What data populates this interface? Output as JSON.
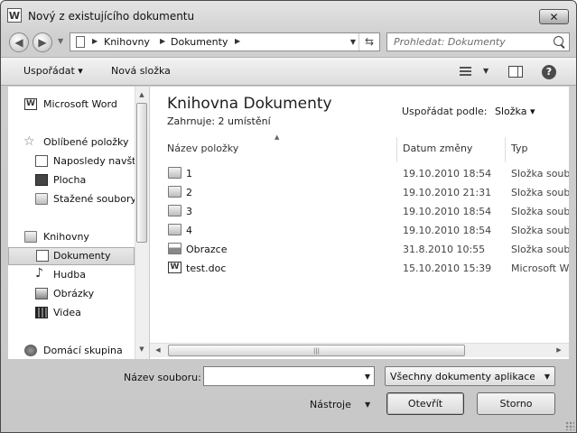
{
  "window": {
    "title": "Nový z existujícího dokumentu",
    "app_icon_letter": "W",
    "close_glyph": "✕"
  },
  "nav": {
    "back_glyph": "◀",
    "forward_glyph": "▶",
    "breadcrumb": [
      "Knihovny",
      "Dokumenty"
    ],
    "search_placeholder": "Prohledat: Dokumenty"
  },
  "toolbar": {
    "organize_label": "Uspořádat ▾",
    "new_folder_label": "Nová složka"
  },
  "sidebar": {
    "items": [
      {
        "label": "Microsoft Word",
        "icon": "word-icon"
      },
      {
        "label": "Oblíbené položky",
        "icon": "star-icon"
      },
      {
        "label": "Naposledy navští",
        "icon": "recent-places-icon"
      },
      {
        "label": "Plocha",
        "icon": "desktop-icon"
      },
      {
        "label": "Stažené soubory",
        "icon": "downloads-icon"
      },
      {
        "label": "Knihovny",
        "icon": "libraries-icon"
      },
      {
        "label": "Dokumenty",
        "icon": "documents-icon",
        "selected": true
      },
      {
        "label": "Hudba",
        "icon": "music-icon"
      },
      {
        "label": "Obrázky",
        "icon": "pictures-icon"
      },
      {
        "label": "Videa",
        "icon": "videos-icon"
      },
      {
        "label": "Domácí skupina",
        "icon": "homegroup-icon"
      }
    ]
  },
  "library": {
    "title": "Knihovna Dokumenty",
    "subtitle": "Zahrnuje:  2 umístění",
    "sort_label": "Uspořádat podle:",
    "sort_value": "Složka ▾"
  },
  "columns": {
    "name": "Název položky",
    "date": "Datum změny",
    "type": "Typ"
  },
  "files": [
    {
      "name": "1",
      "date": "19.10.2010 18:54",
      "type": "Složka souborů",
      "icon": "folder-icon"
    },
    {
      "name": "2",
      "date": "19.10.2010 21:31",
      "type": "Složka souborů",
      "icon": "folder-icon"
    },
    {
      "name": "3",
      "date": "19.10.2010 18:54",
      "type": "Složka souborů",
      "icon": "folder-icon"
    },
    {
      "name": "4",
      "date": "19.10.2010 18:54",
      "type": "Složka souborů",
      "icon": "folder-icon"
    },
    {
      "name": "Obrazce",
      "date": "31.8.2010 10:55",
      "type": "Složka souborů",
      "icon": "folder-pictures-icon"
    },
    {
      "name": "test.doc",
      "date": "15.10.2010 15:39",
      "type": "Microsoft Word",
      "icon": "word-doc-icon"
    }
  ],
  "bottom": {
    "filename_label": "Název souboru:",
    "filename_value": "",
    "filter_value": "Všechny dokumenty aplikace Word",
    "tools_label": "Nástroje",
    "open_label": "Otevřít",
    "cancel_label": "Storno"
  }
}
